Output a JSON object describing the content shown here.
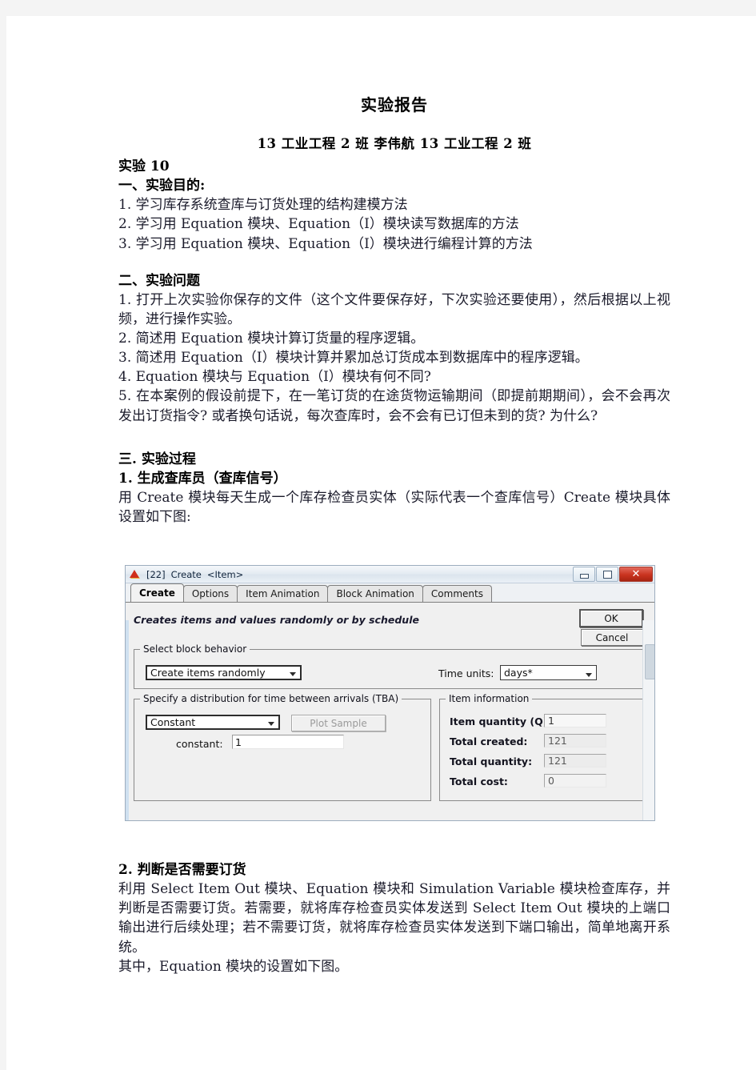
{
  "document": {
    "title": "实验报告",
    "subtitle": "13 工业工程 2 班  李伟航  13 工业工程 2 班",
    "experiment_label": "实验 10",
    "section1_heading": "一、实验目的:",
    "objectives": [
      "1. 学习库存系统查库与订货处理的结构建模方法",
      "2. 学习用 Equation 模块、Equation（I）模块读写数据库的方法",
      "3. 学习用 Equation 模块、Equation（I）模块进行编程计算的方法"
    ],
    "section2_heading": "二、实验问题",
    "questions": [
      "1. 打开上次实验你保存的文件（这个文件要保存好，下次实验还要使用），然后根据以上视频，进行操作实验。",
      "2. 简述用 Equation 模块计算订货量的程序逻辑。",
      "3. 简述用 Equation（I）模块计算并累加总订货成本到数据库中的程序逻辑。",
      "4. Equation 模块与 Equation（I）模块有何不同?",
      "5. 在本案例的假设前提下，在一笔订货的在途货物运输期间（即提前期期间），会不会再次发出订货指令? 或者换句话说，每次查库时，会不会有已订但未到的货? 为什么?"
    ],
    "section3_heading": "三. 实验过程",
    "step1_heading": "1. 生成查库员（查库信号）",
    "step1_text": "用 Create 模块每天生成一个库存检查员实体（实际代表一个查库信号）Create 模块具体设置如下图:",
    "step2_heading": "2. 判断是否需要订货",
    "step2_text": "利用 Select Item Out 模块、Equation 模块和 Simulation Variable 模块检查库存，并判断是否需要订货。若需要，就将库存检查员实体发送到 Select Item Out 模块的上端口输出进行后续处理；若不需要订货，就将库存检查员实体发送到下端口输出，简单地离开系统。",
    "step2_text2": "其中，Equation 模块的设置如下图。"
  },
  "dialog": {
    "title_number": "[22]",
    "title_name": "Create",
    "title_suffix": "<Item>",
    "icon": "extendsim-triangle-icon",
    "window_buttons": {
      "minimize": "minimize-icon",
      "maximize": "maximize-icon",
      "close": "✕"
    },
    "tabs": [
      {
        "label": "Create",
        "active": true
      },
      {
        "label": "Options",
        "active": false
      },
      {
        "label": "Item Animation",
        "active": false
      },
      {
        "label": "Block Animation",
        "active": false
      },
      {
        "label": "Comments",
        "active": false
      }
    ],
    "description": "Creates items and values randomly or by schedule",
    "buttons": {
      "ok": "OK",
      "cancel": "Cancel",
      "plot_sample": "Plot Sample"
    },
    "block_behavior": {
      "legend": "Select block behavior",
      "mode_value": "Create items randomly",
      "time_units_label": "Time units:",
      "time_units_value": "days*"
    },
    "tba": {
      "legend": "Specify a distribution for time between arrivals (TBA)",
      "distribution_value": "Constant",
      "constant_label": "constant:",
      "constant_value": "1"
    },
    "item_information": {
      "legend": "Item information",
      "rows": [
        {
          "label": "Item quantity (Q):",
          "value": "1"
        },
        {
          "label": "Total created:",
          "value": "121"
        },
        {
          "label": "Total quantity:",
          "value": "121"
        },
        {
          "label": "Total cost:",
          "value": "0"
        }
      ]
    }
  }
}
